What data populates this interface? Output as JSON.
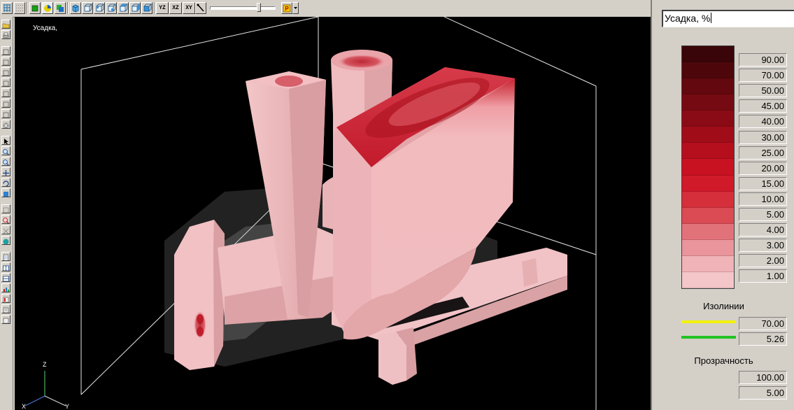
{
  "viewport": {
    "label": "Усадка,"
  },
  "toolbar": {
    "buttons": [
      "YZ",
      "XZ",
      "XY"
    ],
    "slider_value": 0.78
  },
  "panel": {
    "field_value": "Усадка, %",
    "scale": {
      "values": [
        "90.00",
        "70.00",
        "50.00",
        "45.00",
        "40.00",
        "30.00",
        "25.00",
        "20.00",
        "15.00",
        "10.00",
        "5.00",
        "4.00",
        "3.00",
        "2.00",
        "1.00"
      ],
      "colors": [
        "#3a0508",
        "#4d070b",
        "#62080e",
        "#760a12",
        "#8a0b15",
        "#a00d19",
        "#b50f1d",
        "#c81222",
        "#d01a2a",
        "#d42f3b",
        "#da4b54",
        "#e2727a",
        "#ea959b",
        "#f0b3b8",
        "#f4c6c9"
      ]
    },
    "isolines": {
      "title": "Изолинии",
      "items": [
        {
          "color": "#f2f200",
          "value": "70.00"
        },
        {
          "color": "#22c322",
          "value": "5.26"
        }
      ]
    },
    "transparency": {
      "title": "Прозрачность",
      "values": [
        "100.00",
        "5.00"
      ]
    }
  },
  "axes": {
    "labels": [
      "Z",
      "X",
      "Y"
    ]
  }
}
